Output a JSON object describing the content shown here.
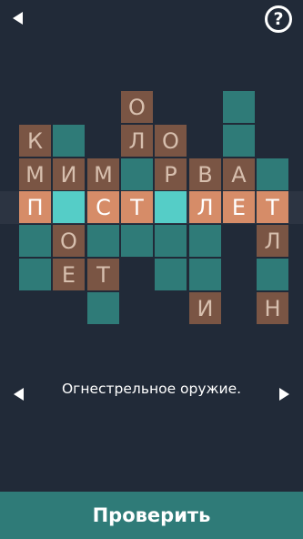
{
  "header": {
    "back_icon": "back-arrow-icon",
    "help_icon": "question-circle-icon",
    "help_symbol": "?"
  },
  "grid": {
    "rows": [
      {
        "row": 0,
        "cells": [
          {
            "col": 3,
            "state": "filled",
            "letter": "О"
          },
          {
            "col": 6,
            "state": "empty",
            "letter": ""
          }
        ]
      },
      {
        "row": 1,
        "cells": [
          {
            "col": 0,
            "state": "filled",
            "letter": "К"
          },
          {
            "col": 1,
            "state": "empty",
            "letter": ""
          },
          {
            "col": 3,
            "state": "filled",
            "letter": "Л"
          },
          {
            "col": 4,
            "state": "filled",
            "letter": "О"
          },
          {
            "col": 6,
            "state": "empty",
            "letter": ""
          }
        ]
      },
      {
        "row": 2,
        "cells": [
          {
            "col": 0,
            "state": "filled",
            "letter": "М"
          },
          {
            "col": 1,
            "state": "filled",
            "letter": "И"
          },
          {
            "col": 2,
            "state": "filled",
            "letter": "М"
          },
          {
            "col": 3,
            "state": "empty",
            "letter": ""
          },
          {
            "col": 4,
            "state": "filled",
            "letter": "Р"
          },
          {
            "col": 5,
            "state": "filled",
            "letter": "В"
          },
          {
            "col": 6,
            "state": "filled",
            "letter": "А"
          },
          {
            "col": 7,
            "state": "empty",
            "letter": ""
          }
        ]
      },
      {
        "row": 3,
        "cells": [
          {
            "col": 0,
            "state": "active",
            "letter": "П"
          },
          {
            "col": 1,
            "state": "cursor",
            "letter": ""
          },
          {
            "col": 2,
            "state": "active",
            "letter": "С"
          },
          {
            "col": 3,
            "state": "active",
            "letter": "Т"
          },
          {
            "col": 4,
            "state": "cursor",
            "letter": ""
          },
          {
            "col": 5,
            "state": "active",
            "letter": "Л"
          },
          {
            "col": 6,
            "state": "active",
            "letter": "Е"
          },
          {
            "col": 7,
            "state": "active",
            "letter": "Т"
          }
        ]
      },
      {
        "row": 4,
        "cells": [
          {
            "col": 0,
            "state": "empty",
            "letter": ""
          },
          {
            "col": 1,
            "state": "filled",
            "letter": "О"
          },
          {
            "col": 2,
            "state": "empty",
            "letter": ""
          },
          {
            "col": 3,
            "state": "empty",
            "letter": ""
          },
          {
            "col": 4,
            "state": "empty",
            "letter": ""
          },
          {
            "col": 5,
            "state": "empty",
            "letter": ""
          },
          {
            "col": 7,
            "state": "filled",
            "letter": "Л"
          }
        ]
      },
      {
        "row": 5,
        "cells": [
          {
            "col": 0,
            "state": "empty",
            "letter": ""
          },
          {
            "col": 1,
            "state": "filled",
            "letter": "Е"
          },
          {
            "col": 2,
            "state": "filled",
            "letter": "Т"
          },
          {
            "col": 4,
            "state": "empty",
            "letter": ""
          },
          {
            "col": 5,
            "state": "empty",
            "letter": ""
          },
          {
            "col": 7,
            "state": "empty",
            "letter": ""
          }
        ]
      },
      {
        "row": 6,
        "cells": [
          {
            "col": 2,
            "state": "empty",
            "letter": ""
          },
          {
            "col": 5,
            "state": "filled",
            "letter": "И"
          },
          {
            "col": 7,
            "state": "filled",
            "letter": "Н"
          }
        ]
      }
    ]
  },
  "clue": {
    "prev_icon": "triangle-left-icon",
    "next_icon": "triangle-right-icon",
    "text": "Огнестрельное оружие."
  },
  "footer": {
    "check_label": "Проверить"
  },
  "colors": {
    "background": "#212a38",
    "empty_cell": "#2f7b78",
    "filled_cell": "#7a5544",
    "filled_letter": "#d7bfae",
    "active_cell": "#d68c68",
    "cursor_cell": "#55cdc7",
    "check_button": "#2f7b78"
  }
}
